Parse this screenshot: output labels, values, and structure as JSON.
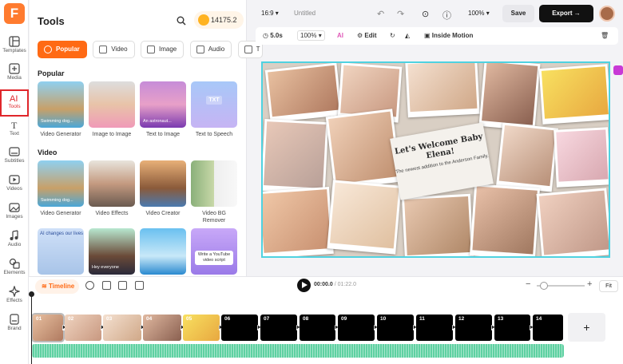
{
  "app": {
    "logo_letter": "F"
  },
  "rail": {
    "items": [
      {
        "label": "Templates",
        "icon": "templates-icon"
      },
      {
        "label": "Media",
        "icon": "media-icon"
      },
      {
        "label": "Tools",
        "icon": "ai-tools-icon",
        "active": true
      },
      {
        "label": "Text",
        "icon": "text-icon"
      },
      {
        "label": "Subtitles",
        "icon": "subtitles-icon"
      },
      {
        "label": "Videos",
        "icon": "videos-icon"
      },
      {
        "label": "Images",
        "icon": "images-icon"
      },
      {
        "label": "Audio",
        "icon": "audio-icon"
      },
      {
        "label": "Elements",
        "icon": "elements-icon"
      },
      {
        "label": "Effects",
        "icon": "effects-icon"
      },
      {
        "label": "Brand",
        "icon": "brand-icon"
      }
    ]
  },
  "panel": {
    "title": "Tools",
    "credits": "14175.2",
    "tabs": [
      "Popular",
      "Video",
      "Image",
      "Audio",
      "T"
    ],
    "popular_heading": "Popular",
    "popular": [
      {
        "label": "Video Generator",
        "caption": "Swimming dog..."
      },
      {
        "label": "Image to Image",
        "caption": ""
      },
      {
        "label": "Text to Image",
        "caption": "An astronaut..."
      },
      {
        "label": "Text to Speech",
        "caption": "TXT"
      }
    ],
    "video_heading": "Video",
    "video": [
      {
        "label": "Video Generator",
        "caption": "Swimming dog..."
      },
      {
        "label": "Video Effects",
        "caption": ""
      },
      {
        "label": "Video Creator",
        "caption": ""
      },
      {
        "label": "Video BG Remover",
        "caption": ""
      }
    ],
    "more": [
      {
        "caption": "AI changes our lives"
      },
      {
        "caption": "Hey everyone"
      },
      {
        "caption": ""
      },
      {
        "caption": "Write a YouTube video script"
      }
    ]
  },
  "topbar": {
    "ratio": "16:9",
    "doc_title": "Untitled",
    "zoom": "100%",
    "save": "Save",
    "export": "Export"
  },
  "toolbar2": {
    "duration": "5.0s",
    "scale": "100%",
    "edit": "Edit",
    "inside_motion": "Inside Motion"
  },
  "canvas": {
    "headline": "Let's Welcome Baby Elena!",
    "subline": "The newest addition to the Anderson Family."
  },
  "timeline": {
    "label": "Timeline",
    "current_time": "00:00.0",
    "total_time": "01:22.0",
    "fit": "Fit",
    "clips": [
      "01",
      "02",
      "03",
      "04",
      "05",
      "06",
      "07",
      "08",
      "09",
      "10",
      "11",
      "12",
      "13",
      "14"
    ],
    "add": "+"
  },
  "colors": {
    "accent": "#ff6a14",
    "selection": "#4fd2e0",
    "audio": "#5fd1a2",
    "active_outline": "#e0262b"
  }
}
